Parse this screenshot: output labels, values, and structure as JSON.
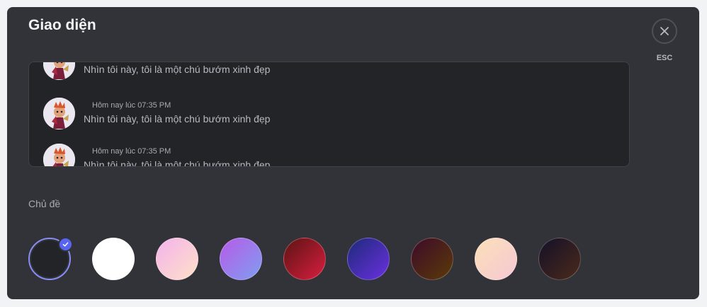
{
  "modal": {
    "title": "Giao diện",
    "close": {
      "icon": "close-icon",
      "label": "ESC"
    }
  },
  "preview": {
    "messages": [
      {
        "timestamp": "",
        "text": "Nhìn tôi này, tôi là một chú bướm xinh đẹp",
        "avatar": "avatar"
      },
      {
        "timestamp": "Hôm nay lúc 07:35 PM",
        "text": "Nhìn tôi này, tôi là một chú bướm xinh đẹp",
        "avatar": "avatar"
      },
      {
        "timestamp": "Hôm nay lúc 07:35 PM",
        "text": "Nhìn tôi này, tôi là một chú bướm xinh đẹp",
        "avatar": "avatar"
      }
    ]
  },
  "theme": {
    "label": "Chủ đề",
    "selected_index": 0,
    "selected_icon": "check-icon",
    "options": [
      {
        "name": "dark",
        "colors": [
          "#232428",
          "#232428"
        ]
      },
      {
        "name": "light",
        "colors": [
          "#ffffff",
          "#ffffff"
        ]
      },
      {
        "name": "pink",
        "colors": [
          "#f3b3ec",
          "#ffe0c8"
        ]
      },
      {
        "name": "violet-pink",
        "colors": [
          "#b85ae8",
          "#7f9ef0"
        ]
      },
      {
        "name": "crimson",
        "colors": [
          "#5c1414",
          "#d81e3e"
        ]
      },
      {
        "name": "blue-indigo",
        "colors": [
          "#1e2a7a",
          "#6a30e0"
        ]
      },
      {
        "name": "maroon-amber",
        "colors": [
          "#3d0a2a",
          "#5a3a08"
        ]
      },
      {
        "name": "peach",
        "colors": [
          "#fbe0b8",
          "#f6c8d4"
        ]
      },
      {
        "name": "midnight",
        "colors": [
          "#141028",
          "#4a2a1a"
        ]
      }
    ]
  }
}
